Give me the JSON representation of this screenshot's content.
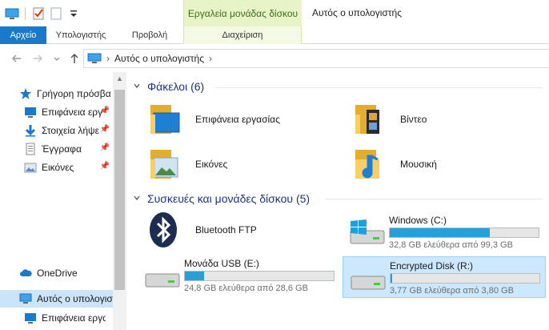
{
  "window": {
    "title": "Αυτός ο υπολογιστής",
    "context_tab_header": "Εργαλεία μονάδας δίσκου"
  },
  "ribbon": {
    "tabs": [
      {
        "label": "Αρχείο"
      },
      {
        "label": "Υπολογιστής"
      },
      {
        "label": "Προβολή"
      },
      {
        "label": "Διαχείριση"
      }
    ]
  },
  "address": {
    "crumb": "Αυτός ο υπολογιστής",
    "chevron": "›"
  },
  "sidebar": {
    "items": [
      {
        "label": "Γρήγορη πρόσβα",
        "icon": "star-icon",
        "pinned": false
      },
      {
        "label": "Επιφάνεια εργ",
        "icon": "desktop-icon",
        "pinned": true
      },
      {
        "label": "Στοιχεία λήψε",
        "icon": "download-icon",
        "pinned": true
      },
      {
        "label": "Έγγραφα",
        "icon": "document-icon",
        "pinned": true
      },
      {
        "label": "Εικόνες",
        "icon": "pictures-icon",
        "pinned": true
      },
      {
        "label": "OneDrive",
        "icon": "cloud-icon",
        "pinned": false
      },
      {
        "label": "Αυτός ο υπολογισ",
        "icon": "computer-icon",
        "pinned": false
      },
      {
        "label": "Επιφάνεια εργασ",
        "icon": "desktop-icon",
        "pinned": false
      }
    ]
  },
  "folders": {
    "header": "Φάκελοι (6)",
    "items": [
      {
        "label": "Επιφάνεια εργασίας",
        "icon": "desktop-folder-icon"
      },
      {
        "label": "Βίντεο",
        "icon": "video-folder-icon"
      },
      {
        "label": "Εικόνες",
        "icon": "pictures-folder-icon"
      },
      {
        "label": "Μουσική",
        "icon": "music-folder-icon"
      }
    ]
  },
  "devices": {
    "header": "Συσκευές και μονάδες δίσκου (5)",
    "items": [
      {
        "label": "Bluetooth FTP",
        "icon": "bluetooth-icon"
      },
      {
        "label": "Windows (C:)",
        "free_text": "32,8 GB ελεύθερα από 99,3 GB",
        "used_fraction": 0.67,
        "icon": "windows-drive-icon"
      },
      {
        "label": "Μονάδα USB (E:)",
        "free_text": "24,8 GB ελεύθερα από 28,6 GB",
        "used_fraction": 0.13,
        "icon": "usb-drive-icon"
      },
      {
        "label": "Encrypted Disk (R:)",
        "free_text": "3,77 GB ελεύθερα από 3,80 GB",
        "used_fraction": 0.01,
        "icon": "drive-icon",
        "selected": true
      }
    ]
  },
  "colors": {
    "accent": "#1979ca",
    "group_header": "#1e3287",
    "drive_bar": "#26a0da",
    "selection": "#cce8ff"
  }
}
